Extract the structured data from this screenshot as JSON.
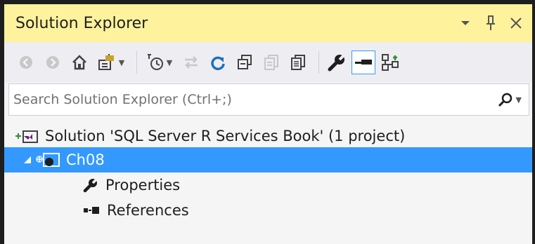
{
  "window": {
    "title": "Solution Explorer",
    "controls": [
      "dropdown-arrow-icon",
      "pin-icon",
      "close-icon"
    ]
  },
  "toolbar": {
    "buttons": [
      {
        "icon": "back-icon",
        "enabled": false
      },
      {
        "icon": "forward-icon",
        "enabled": false
      },
      {
        "icon": "home-icon",
        "enabled": true
      },
      {
        "icon": "switch-views-icon",
        "enabled": true,
        "dropdown": true
      },
      {
        "icon": "pending-changes-filter-icon",
        "enabled": true,
        "dropdown": true
      },
      {
        "icon": "sync-with-active-document-icon",
        "enabled": false
      },
      {
        "icon": "refresh-icon",
        "enabled": true
      },
      {
        "icon": "collapse-all-icon",
        "enabled": true
      },
      {
        "icon": "show-all-files-icon",
        "enabled": false
      },
      {
        "icon": "view-code-icon",
        "enabled": true
      },
      {
        "icon": "properties-icon",
        "enabled": true
      },
      {
        "icon": "preview-selected-items-icon",
        "enabled": true,
        "active": true
      },
      {
        "icon": "class-view-icon",
        "enabled": true
      }
    ]
  },
  "search": {
    "placeholder": "Search Solution Explorer (Ctrl+;)",
    "value": ""
  },
  "tree": {
    "solution_label": "Solution 'SQL Server R Services Book' (1 project)",
    "project_label": "Ch08",
    "children": [
      {
        "label": "Properties",
        "icon": "wrench-icon"
      },
      {
        "label": "References",
        "icon": "references-icon"
      }
    ]
  },
  "colors": {
    "title_bar": "#fff29d",
    "selection": "#3399ff",
    "background": "#f5f5f5",
    "toolbar_bg": "#eeeef2"
  }
}
